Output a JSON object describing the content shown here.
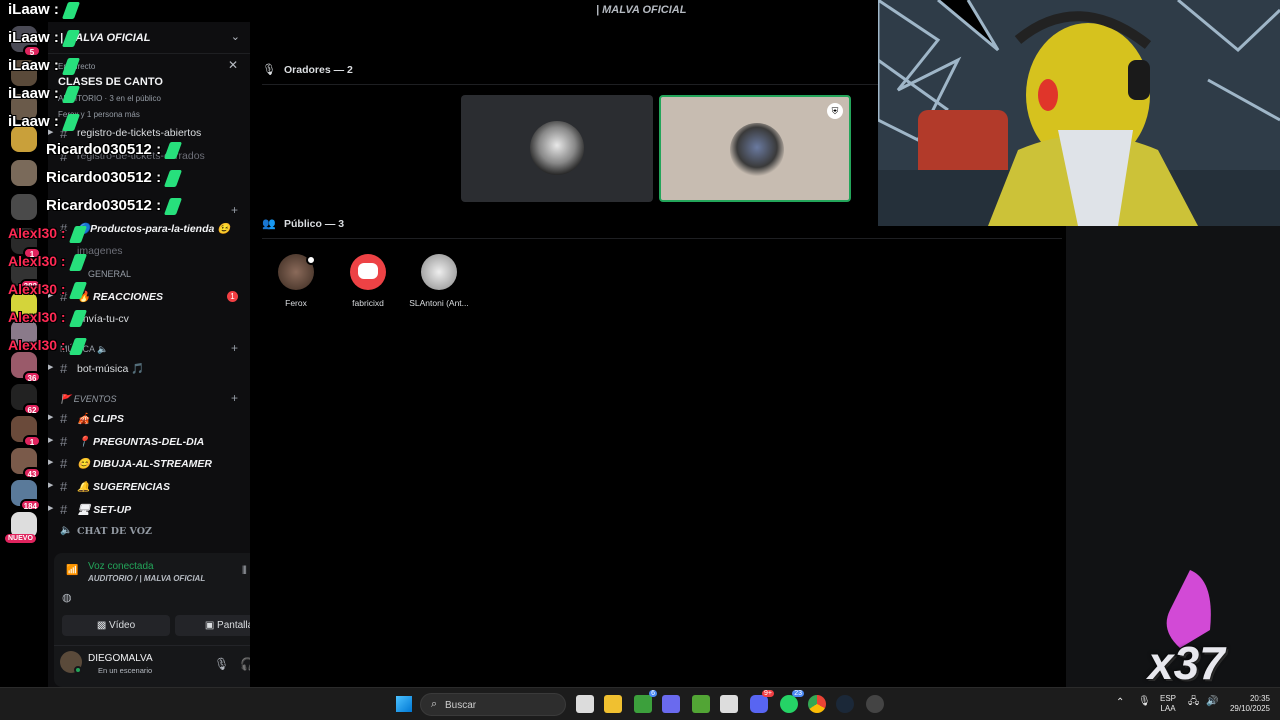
{
  "window_title": "| MALVA OFICIAL",
  "server": {
    "name": "| MALVA OFICIAL"
  },
  "rail": {
    "badges": [
      "5",
      "1",
      "382",
      "36",
      "62",
      "1",
      "43",
      "184"
    ],
    "new_badge": "NUEVO"
  },
  "event": {
    "small": "En Directo",
    "title": "CLASES DE CANTO",
    "subtitle": "AUDITORIO · 3 en el público",
    "subtitle2": "Ferox y 1 persona más"
  },
  "channels": [
    {
      "label": "registro-de-tickets-abiertos",
      "style": "normal"
    },
    {
      "label": "registro-de-tickets-cerrados",
      "style": "dim"
    },
    {
      "label": "🔵Productos-para-la-tienda 😉",
      "style": "bold"
    },
    {
      "label": "imagenes",
      "style": "dim"
    },
    {
      "label": "🔥 REACCIONES",
      "style": "bold",
      "badge": "1"
    },
    {
      "label": "envía-tu-cv",
      "style": "normal"
    },
    {
      "label": "bot-música 🎵",
      "style": "normal"
    },
    {
      "label": "🎪 CLIPS",
      "style": "bold"
    },
    {
      "label": "📍 PREGUNTAS-DEL-DIA",
      "style": "bold"
    },
    {
      "label": "😊 DIBUJA-AL-STREAMER",
      "style": "bold"
    },
    {
      "label": "🔔 SUGERENCIAS",
      "style": "bold"
    },
    {
      "label": "🖥 SET-UP",
      "style": "bold"
    }
  ],
  "categories": {
    "general": "GENERAL",
    "musica": "MÚSICA 🔈",
    "eventos": "🚩 EVENTOS",
    "chat_voz": "CHAT DE VOZ"
  },
  "voice_panel": {
    "status": "Voz conectada",
    "location": "AUDITORIO / | MALVA OFICIAL",
    "video_label": "Vídeo",
    "screen_label": "Pantalla"
  },
  "user": {
    "name": "DIEGOMALVA",
    "status": "En un escenario"
  },
  "stage": {
    "speakers_label": "Oradores — 2",
    "audience_label": "Público — 3",
    "audience": [
      {
        "name": "Ferox"
      },
      {
        "name": "fabricixd"
      },
      {
        "name": "SLAntoni (Ant..."
      }
    ]
  },
  "overlay": {
    "chat": [
      {
        "user": "iLaaw :",
        "color": "white"
      },
      {
        "user": "iLaaw :",
        "color": "white"
      },
      {
        "user": "iLaaw :",
        "color": "white"
      },
      {
        "user": "iLaaw :",
        "color": "white"
      },
      {
        "user": "iLaaw :",
        "color": "white"
      },
      {
        "user": "Ricardo030512 :",
        "color": "white"
      },
      {
        "user": "Ricardo030512 :",
        "color": "white"
      },
      {
        "user": "Ricardo030512 :",
        "color": "white"
      },
      {
        "user": "Alexl30 :",
        "color": "red"
      },
      {
        "user": "Alexl30 :",
        "color": "red"
      },
      {
        "user": "Alexl30 :",
        "color": "red"
      },
      {
        "user": "Alexl30 :",
        "color": "red"
      },
      {
        "user": "Alexl30 :",
        "color": "red"
      }
    ],
    "multiplier": "x37"
  },
  "taskbar": {
    "search_placeholder": "Buscar",
    "lang": "ESP",
    "lang2": "LAA",
    "time": "20:35",
    "date": "29/10/2025",
    "badges": {
      "teams": "6",
      "discord": "9+",
      "whatsapp": "23"
    }
  },
  "colors": {
    "accent_green": "#23a55a",
    "badge_red": "#f23f43",
    "discord": "#ed4245"
  }
}
